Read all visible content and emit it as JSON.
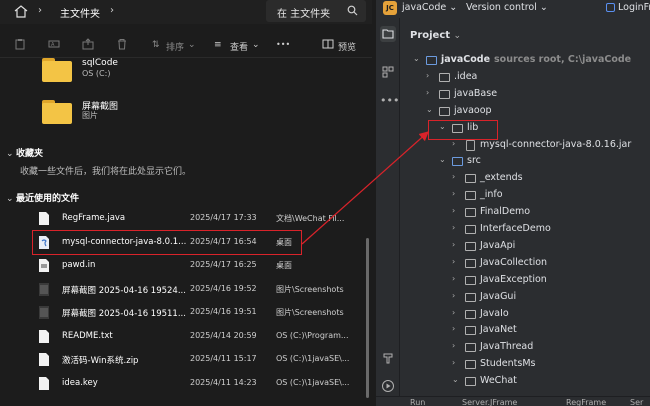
{
  "explorer": {
    "path_label": "主文件夹",
    "search_label": "在 主文件夹",
    "toolbar": {
      "sort_label": "排序",
      "view_label": "查看",
      "more_label": "•••",
      "preview_label": "预览"
    },
    "pinned": [
      {
        "name": "sqlCode",
        "sub": "OS (C:)"
      },
      {
        "name": "屏幕截图",
        "sub": "图片"
      }
    ],
    "favorites": {
      "title": "收藏夹",
      "empty_text": "收藏一些文件后，我们将在此处显示它们。"
    },
    "recent": {
      "title": "最近使用的文件",
      "files": [
        {
          "name": "RegFrame.java",
          "date": "2025/4/17 17:33",
          "location": "文档\\WeChat Fil...",
          "icon": "doc"
        },
        {
          "name": "mysql-connector-java-8.0.1...",
          "date": "2025/4/17 16:54",
          "location": "桌面",
          "icon": "jar"
        },
        {
          "name": "pawd.in",
          "date": "2025/4/17 16:25",
          "location": "桌面",
          "icon": "ini"
        },
        {
          "name": "屏幕截图 2025-04-16 19524...",
          "date": "2025/4/16 19:52",
          "location": "图片\\Screenshots",
          "icon": "img"
        },
        {
          "name": "屏幕截图 2025-04-16 19511...",
          "date": "2025/4/16 19:51",
          "location": "图片\\Screenshots",
          "icon": "img"
        },
        {
          "name": "README.txt",
          "date": "2025/4/14 20:59",
          "location": "OS (C:)\\Program...",
          "icon": "doc"
        },
        {
          "name": "激活码-Win系统.zip",
          "date": "2025/4/11 15:17",
          "location": "OS (C:)\\1javaSE\\...",
          "icon": "doc"
        },
        {
          "name": "idea.key",
          "date": "2025/4/11 14:23",
          "location": "OS (C:)\\1javaSE\\...",
          "icon": "doc"
        }
      ]
    }
  },
  "ide": {
    "project_name": "javaCode",
    "badge": "JC",
    "version_control": "Version control",
    "run_config": "LoginFr",
    "panel_title": "Project",
    "tree": [
      {
        "label": "javaCode",
        "hint": "sources root,  C:\\javaCode",
        "depth": 0,
        "arrow": "⌄",
        "kind": "folder-blue",
        "bold": true
      },
      {
        "label": ".idea",
        "depth": 1,
        "arrow": "›",
        "kind": "folder"
      },
      {
        "label": "javaBase",
        "depth": 1,
        "arrow": "›",
        "kind": "folder"
      },
      {
        "label": "javaoop",
        "depth": 1,
        "arrow": "⌄",
        "kind": "folder"
      },
      {
        "label": "lib",
        "depth": 2,
        "arrow": "⌄",
        "kind": "folder"
      },
      {
        "label": "mysql-connector-java-8.0.16.jar",
        "depth": 3,
        "arrow": "›",
        "kind": "jar"
      },
      {
        "label": "src",
        "depth": 2,
        "arrow": "⌄",
        "kind": "folder-src"
      },
      {
        "label": "_extends",
        "depth": 3,
        "arrow": "›",
        "kind": "folder"
      },
      {
        "label": "_info",
        "depth": 3,
        "arrow": "›",
        "kind": "folder"
      },
      {
        "label": "FinalDemo",
        "depth": 3,
        "arrow": "›",
        "kind": "folder"
      },
      {
        "label": "InterfaceDemo",
        "depth": 3,
        "arrow": "›",
        "kind": "folder"
      },
      {
        "label": "JavaApi",
        "depth": 3,
        "arrow": "›",
        "kind": "folder"
      },
      {
        "label": "JavaCollection",
        "depth": 3,
        "arrow": "›",
        "kind": "folder"
      },
      {
        "label": "JavaException",
        "depth": 3,
        "arrow": "›",
        "kind": "folder"
      },
      {
        "label": "JavaGui",
        "depth": 3,
        "arrow": "›",
        "kind": "folder"
      },
      {
        "label": "JavaIo",
        "depth": 3,
        "arrow": "›",
        "kind": "folder"
      },
      {
        "label": "JavaNet",
        "depth": 3,
        "arrow": "›",
        "kind": "folder"
      },
      {
        "label": "JavaThread",
        "depth": 3,
        "arrow": "›",
        "kind": "folder"
      },
      {
        "label": "StudentsMs",
        "depth": 3,
        "arrow": "›",
        "kind": "folder"
      },
      {
        "label": "WeChat",
        "depth": 3,
        "arrow": "⌄",
        "kind": "folder"
      }
    ],
    "bottom_tabs": [
      "Run",
      "Server.JFrame",
      "RegFrame",
      "Ser"
    ]
  },
  "colors": {
    "annotation_red": "#d9232a",
    "folder_yellow": "#f3c445",
    "ide_bg": "#2b2d30",
    "explorer_bg": "#1c1c1c"
  }
}
